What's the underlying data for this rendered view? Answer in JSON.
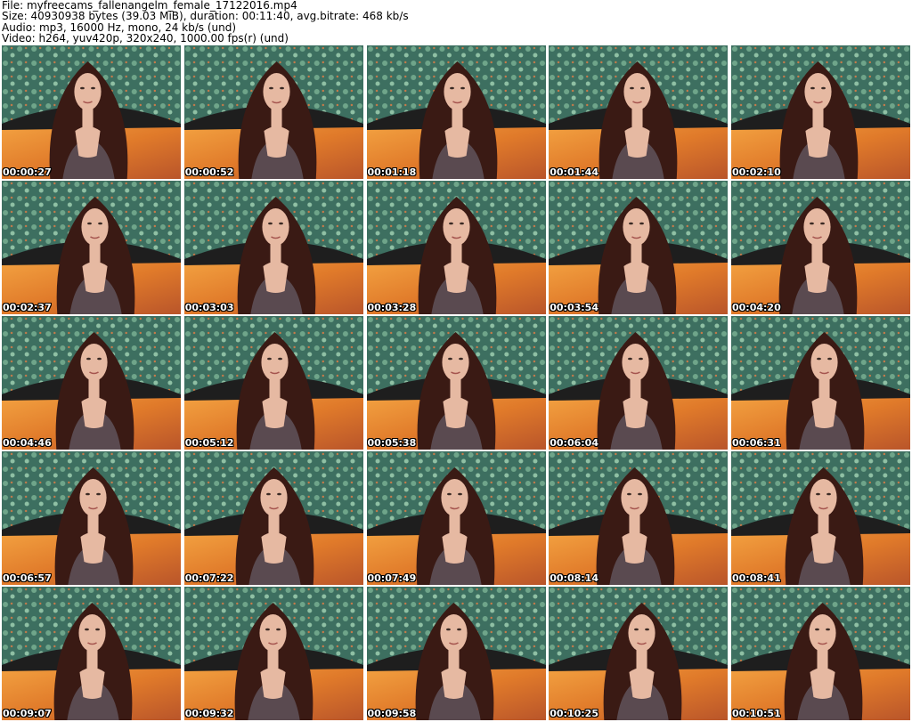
{
  "header": {
    "file_line": "File: myfreecams_fallenangelm_female_17122016.mp4",
    "size_line": "Size: 40930938 bytes (39.03 MiB), duration: 00:11:40, avg.bitrate: 468 kb/s",
    "audio_line": "Audio: mp3, 16000 Hz, mono, 24 kb/s (und)",
    "video_line": "Video: h264, yuv420p, 320x240, 1000.00 fps(r) (und)"
  },
  "colors": {
    "wallpaper": "#3d6f60",
    "bedspread": "#e07a2a",
    "hair": "#3a1a14",
    "skin": "#e6b9a2",
    "top": "#5a4a50",
    "headboard": "#1e1e1e"
  },
  "thumbnails": [
    {
      "timestamp": "00:00:27"
    },
    {
      "timestamp": "00:00:52"
    },
    {
      "timestamp": "00:01:18"
    },
    {
      "timestamp": "00:01:44"
    },
    {
      "timestamp": "00:02:10"
    },
    {
      "timestamp": "00:02:37"
    },
    {
      "timestamp": "00:03:03"
    },
    {
      "timestamp": "00:03:28"
    },
    {
      "timestamp": "00:03:54"
    },
    {
      "timestamp": "00:04:20"
    },
    {
      "timestamp": "00:04:46"
    },
    {
      "timestamp": "00:05:12"
    },
    {
      "timestamp": "00:05:38"
    },
    {
      "timestamp": "00:06:04"
    },
    {
      "timestamp": "00:06:31"
    },
    {
      "timestamp": "00:06:57"
    },
    {
      "timestamp": "00:07:22"
    },
    {
      "timestamp": "00:07:49"
    },
    {
      "timestamp": "00:08:14"
    },
    {
      "timestamp": "00:08:41"
    },
    {
      "timestamp": "00:09:07"
    },
    {
      "timestamp": "00:09:32"
    },
    {
      "timestamp": "00:09:58"
    },
    {
      "timestamp": "00:10:25"
    },
    {
      "timestamp": "00:10:51"
    }
  ]
}
